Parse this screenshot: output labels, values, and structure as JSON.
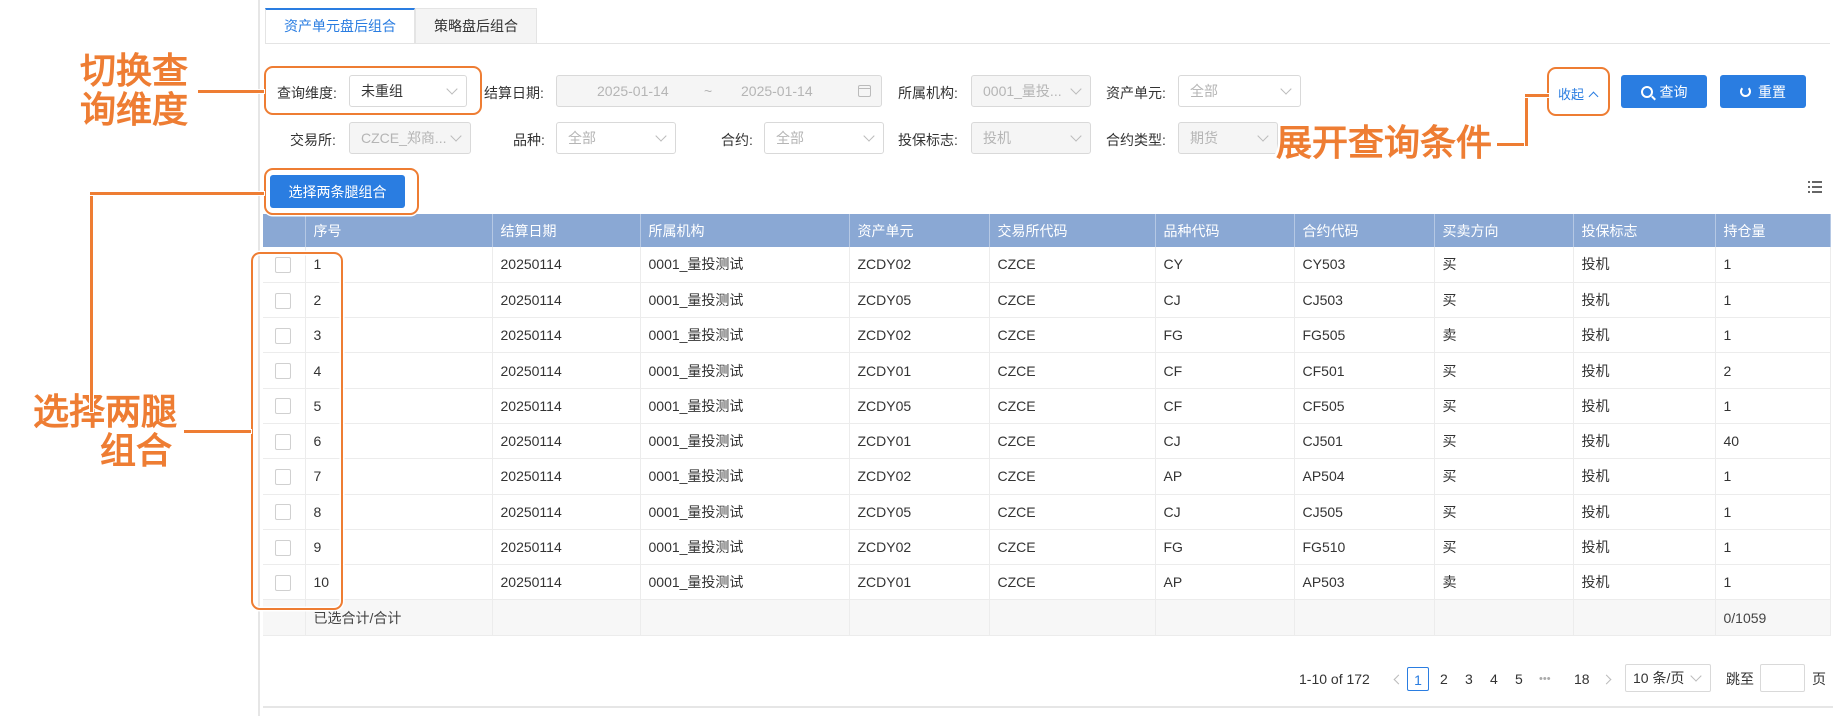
{
  "tabs": [
    {
      "label": "资产单元盘后组合",
      "active": true
    },
    {
      "label": "策略盘后组合",
      "active": false
    }
  ],
  "filters": {
    "query_dim_label": "查询维度:",
    "query_dim_value": "未重组",
    "settle_date_label": "结算日期:",
    "date_start": "2025-01-14",
    "date_sep": "~",
    "date_end": "2025-01-14",
    "org_label": "所属机构:",
    "org_value": "0001_量投...",
    "asset_label": "资产单元:",
    "asset_value": "全部",
    "exchange_label": "交易所:",
    "exchange_value": "CZCE_郑商...",
    "variety_label": "品种:",
    "variety_value": "全部",
    "contract_label": "合约:",
    "contract_value": "全部",
    "hedge_label": "投保标志:",
    "hedge_value": "投机",
    "contract_type_label": "合约类型:",
    "contract_type_value": "期货"
  },
  "actions": {
    "collapse": "收起",
    "query": "查询",
    "reset": "重置",
    "select_two_legs": "选择两条腿组合"
  },
  "table": {
    "columns": [
      "序号",
      "结算日期",
      "所属机构",
      "资产单元",
      "交易所代码",
      "品种代码",
      "合约代码",
      "买卖方向",
      "投保标志",
      "持仓量"
    ],
    "rows": [
      [
        "1",
        "20250114",
        "0001_量投测试",
        "ZCDY02",
        "CZCE",
        "CY",
        "CY503",
        "买",
        "投机",
        "1"
      ],
      [
        "2",
        "20250114",
        "0001_量投测试",
        "ZCDY05",
        "CZCE",
        "CJ",
        "CJ503",
        "买",
        "投机",
        "1"
      ],
      [
        "3",
        "20250114",
        "0001_量投测试",
        "ZCDY02",
        "CZCE",
        "FG",
        "FG505",
        "卖",
        "投机",
        "1"
      ],
      [
        "4",
        "20250114",
        "0001_量投测试",
        "ZCDY01",
        "CZCE",
        "CF",
        "CF501",
        "买",
        "投机",
        "2"
      ],
      [
        "5",
        "20250114",
        "0001_量投测试",
        "ZCDY05",
        "CZCE",
        "CF",
        "CF505",
        "买",
        "投机",
        "1"
      ],
      [
        "6",
        "20250114",
        "0001_量投测试",
        "ZCDY01",
        "CZCE",
        "CJ",
        "CJ501",
        "买",
        "投机",
        "40"
      ],
      [
        "7",
        "20250114",
        "0001_量投测试",
        "ZCDY02",
        "CZCE",
        "AP",
        "AP504",
        "买",
        "投机",
        "1"
      ],
      [
        "8",
        "20250114",
        "0001_量投测试",
        "ZCDY05",
        "CZCE",
        "CJ",
        "CJ505",
        "买",
        "投机",
        "1"
      ],
      [
        "9",
        "20250114",
        "0001_量投测试",
        "ZCDY02",
        "CZCE",
        "FG",
        "FG510",
        "买",
        "投机",
        "1"
      ],
      [
        "10",
        "20250114",
        "0001_量投测试",
        "ZCDY01",
        "CZCE",
        "AP",
        "AP503",
        "卖",
        "投机",
        "1"
      ]
    ],
    "summary_label": "已选合计/合计",
    "summary_total": "0/1059"
  },
  "pagination": {
    "range": "1-10 of 172",
    "pages": [
      "1",
      "2",
      "3",
      "4",
      "5"
    ],
    "current": "1",
    "ellipsis": "•••",
    "last": "18",
    "page_size": "10 条/页",
    "goto_label": "跳至",
    "page_suffix": "页"
  },
  "annotations": {
    "switch_dim_line1": "切换查",
    "switch_dim_line2": "询维度",
    "expand_query": "展开查询条件",
    "select_legs_line1": "选择两腿",
    "select_legs_line2": "组合"
  },
  "colors": {
    "accent": "#2a7de1",
    "header_bg": "#8aa8d4",
    "annotation": "#ee7d33"
  }
}
